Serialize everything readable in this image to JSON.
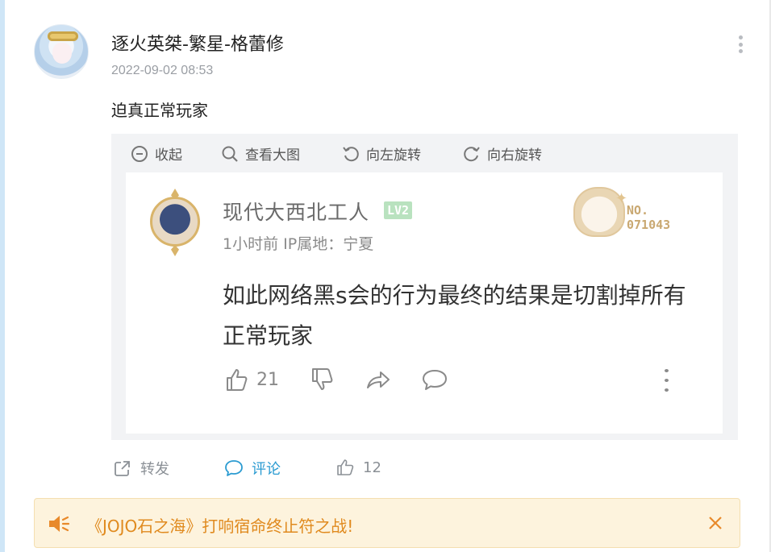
{
  "post": {
    "author": "逐火英桀-繁星-格蕾修",
    "timestamp": "2022-09-02 08:53",
    "text": "迫真正常玩家"
  },
  "viewer": {
    "toolbar": {
      "collapse": "收起",
      "zoom": "查看大图",
      "rotate_left": "向左旋转",
      "rotate_right": "向右旋转"
    }
  },
  "screenshot": {
    "author": "现代大西北工人",
    "level": "LV2",
    "meta": "1小时前  IP属地：宁夏",
    "content": "如此网络黑s会的行为最终的结果是切割掉所有正常玩家",
    "likes": "21",
    "badge_label": "NO.",
    "badge_number": "071043"
  },
  "actions": {
    "share": "转发",
    "comment": "评论",
    "likes": "12"
  },
  "banner": {
    "text": "《JOJO石之海》打响宿命终止符之战!"
  },
  "colors": {
    "accent": "#2b9bd1",
    "banner_bg": "#fdf3dd",
    "banner_text": "#e08a1e",
    "level_badge": "#b9e2bf"
  }
}
